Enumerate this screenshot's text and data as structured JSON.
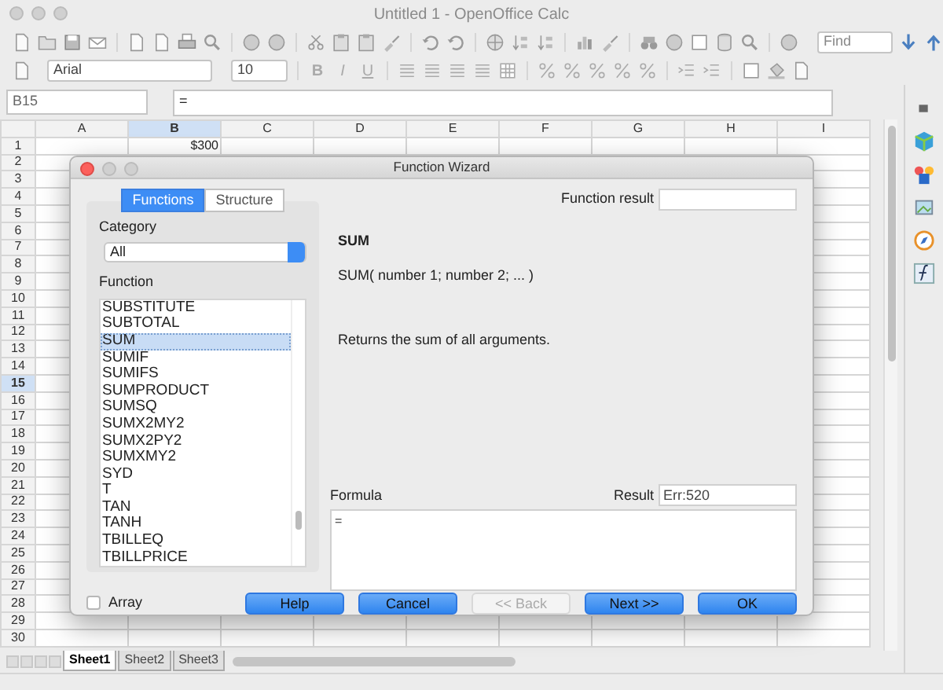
{
  "window": {
    "title": "Untitled 1 - OpenOffice Calc"
  },
  "find": {
    "placeholder": "Find"
  },
  "formatting": {
    "font": "Arial",
    "size": "10",
    "styles": [
      "B",
      "I",
      "U"
    ]
  },
  "formula_bar": {
    "cell": "B15",
    "input": "="
  },
  "sheet": {
    "columns": [
      {
        "label": "A",
        "selected": false
      },
      {
        "label": "B",
        "selected": true
      },
      {
        "label": "C",
        "selected": false
      },
      {
        "label": "D",
        "selected": false
      },
      {
        "label": "E",
        "selected": false
      },
      {
        "label": "F",
        "selected": false
      },
      {
        "label": "G",
        "selected": false
      },
      {
        "label": "H",
        "selected": false
      },
      {
        "label": "I",
        "selected": false
      }
    ],
    "rows": [
      {
        "label": "1",
        "selected": false
      },
      {
        "label": "2",
        "selected": false
      },
      {
        "label": "3",
        "selected": false
      },
      {
        "label": "4",
        "selected": false
      },
      {
        "label": "5",
        "selected": false
      },
      {
        "label": "6",
        "selected": false
      },
      {
        "label": "7",
        "selected": false
      },
      {
        "label": "8",
        "selected": false
      },
      {
        "label": "9",
        "selected": false
      },
      {
        "label": "10",
        "selected": false
      },
      {
        "label": "11",
        "selected": false
      },
      {
        "label": "12",
        "selected": false
      },
      {
        "label": "13",
        "selected": false
      },
      {
        "label": "14",
        "selected": false
      },
      {
        "label": "15",
        "selected": true
      },
      {
        "label": "16",
        "selected": false
      },
      {
        "label": "17",
        "selected": false
      },
      {
        "label": "18",
        "selected": false
      },
      {
        "label": "19",
        "selected": false
      },
      {
        "label": "20",
        "selected": false
      },
      {
        "label": "21",
        "selected": false
      },
      {
        "label": "22",
        "selected": false
      },
      {
        "label": "23",
        "selected": false
      },
      {
        "label": "24",
        "selected": false
      },
      {
        "label": "25",
        "selected": false
      },
      {
        "label": "26",
        "selected": false
      },
      {
        "label": "27",
        "selected": false
      },
      {
        "label": "28",
        "selected": false
      },
      {
        "label": "29",
        "selected": false
      },
      {
        "label": "30",
        "selected": false
      }
    ],
    "cell_b1": "$300"
  },
  "sheet_tabs": [
    {
      "label": "Sheet1",
      "selected": true
    },
    {
      "label": "Sheet2",
      "selected": false
    },
    {
      "label": "Sheet3",
      "selected": false
    }
  ],
  "dialog": {
    "title": "Function Wizard",
    "tabs": [
      {
        "label": "Functions",
        "selected": true
      },
      {
        "label": "Structure",
        "selected": false
      }
    ],
    "category": {
      "label": "Category",
      "value": "All"
    },
    "function_label": "Function",
    "functions": [
      {
        "name": "SUBSTITUTE",
        "selected": false
      },
      {
        "name": "SUBTOTAL",
        "selected": false
      },
      {
        "name": "SUM",
        "selected": true
      },
      {
        "name": "SUMIF",
        "selected": false
      },
      {
        "name": "SUMIFS",
        "selected": false
      },
      {
        "name": "SUMPRODUCT",
        "selected": false
      },
      {
        "name": "SUMSQ",
        "selected": false
      },
      {
        "name": "SUMX2MY2",
        "selected": false
      },
      {
        "name": "SUMX2PY2",
        "selected": false
      },
      {
        "name": "SUMXMY2",
        "selected": false
      },
      {
        "name": "SYD",
        "selected": false
      },
      {
        "name": "T",
        "selected": false
      },
      {
        "name": "TAN",
        "selected": false
      },
      {
        "name": "TANH",
        "selected": false
      },
      {
        "name": "TBILLEQ",
        "selected": false
      },
      {
        "name": "TBILLPRICE",
        "selected": false
      }
    ],
    "function_result_label": "Function result",
    "function_name": "SUM",
    "syntax": "SUM( number 1; number 2; ...  )",
    "description": "Returns the sum of all arguments.",
    "formula": {
      "label": "Formula",
      "value": "="
    },
    "result": {
      "label": "Result",
      "value": "Err:520"
    },
    "array": {
      "label": "Array",
      "checked": false
    },
    "buttons": [
      {
        "label": "Help",
        "disabled": false
      },
      {
        "label": "Cancel",
        "disabled": false
      },
      {
        "label": "<< Back",
        "disabled": true
      },
      {
        "label": "Next >>",
        "disabled": false
      },
      {
        "label": "OK",
        "disabled": false
      }
    ]
  }
}
